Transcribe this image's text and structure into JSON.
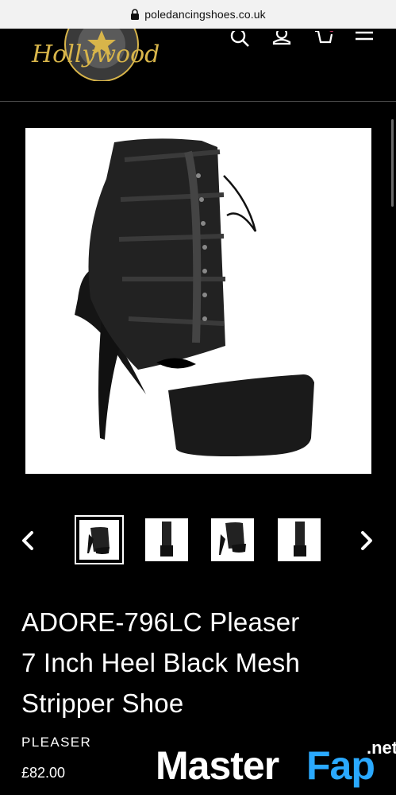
{
  "browser": {
    "url": "poledancingshoes.co.uk"
  },
  "header": {
    "logo_text": "Hollywood",
    "icons": [
      "search-icon",
      "account-icon",
      "cart-icon",
      "menu-icon"
    ]
  },
  "product": {
    "title_lines": [
      "ADORE-796LC Pleaser",
      "7 Inch Heel Black Mesh",
      "Stripper Shoe"
    ],
    "vendor": "PLEASER",
    "price": "£82.00"
  },
  "gallery": {
    "thumbnail_count": 4,
    "active_index": 0
  },
  "watermark": {
    "part1": "Master",
    "part2": "Fap",
    "part3": ".net"
  },
  "colors": {
    "background": "#000000",
    "accent_gold": "#d8b54a",
    "watermark_blue": "#2aa9ff"
  }
}
